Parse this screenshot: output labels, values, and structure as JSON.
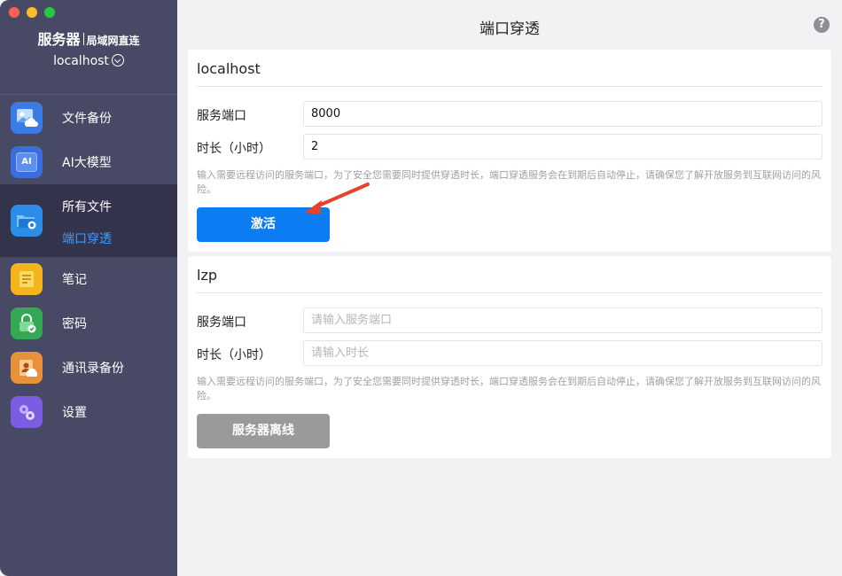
{
  "window": {
    "traffic_lights": {
      "close": "#ff5f57",
      "minimize": "#febc2e",
      "zoom": "#28c840"
    }
  },
  "sidebar": {
    "brand": "服务器",
    "brand_sub": "局域网直连",
    "host": "localhost",
    "items": [
      {
        "label": "文件备份",
        "icon": "photo-cloud-icon",
        "color": "#3b7be8"
      },
      {
        "label": "AI大模型",
        "icon": "ai-chip-icon",
        "color": "#3a6ee0",
        "glyph": "AI"
      },
      {
        "label": "所有文件",
        "sublabel": "端口穿透",
        "icon": "folder-apple-icon",
        "color": "#2b8de8",
        "active": true
      },
      {
        "label": "笔记",
        "icon": "notes-icon",
        "color": "#f3b51b"
      },
      {
        "label": "密码",
        "icon": "lock-check-icon",
        "color": "#34a853"
      },
      {
        "label": "通讯录备份",
        "icon": "contacts-icon",
        "color": "#e8913c"
      },
      {
        "label": "设置",
        "icon": "gear-icon",
        "color": "#7c5ce0"
      }
    ]
  },
  "main": {
    "title": "端口穿透",
    "help_glyph": "?",
    "cards": [
      {
        "name": "localhost",
        "port_label": "服务端口",
        "port_value": "8000",
        "duration_label": "时长（小时）",
        "duration_value": "2",
        "hint": "输入需要远程访问的服务端口，为了安全您需要同时提供穿透时长，端口穿透服务会在到期后自动停止，请确保您了解开放服务到互联网访问的风险。",
        "button": "激活"
      },
      {
        "name": "lzp",
        "port_label": "服务端口",
        "port_placeholder": "请输入服务端口",
        "duration_label": "时长（小时）",
        "duration_placeholder": "请输入时长",
        "hint": "输入需要远程访问的服务端口，为了安全您需要同时提供穿透时长，端口穿透服务会在到期后自动停止，请确保您了解开放服务到互联网访问的风险。",
        "button": "服务器离线"
      }
    ],
    "accent_color": "#0b7cf2",
    "annotation_arrow_color": "#e8412c"
  }
}
